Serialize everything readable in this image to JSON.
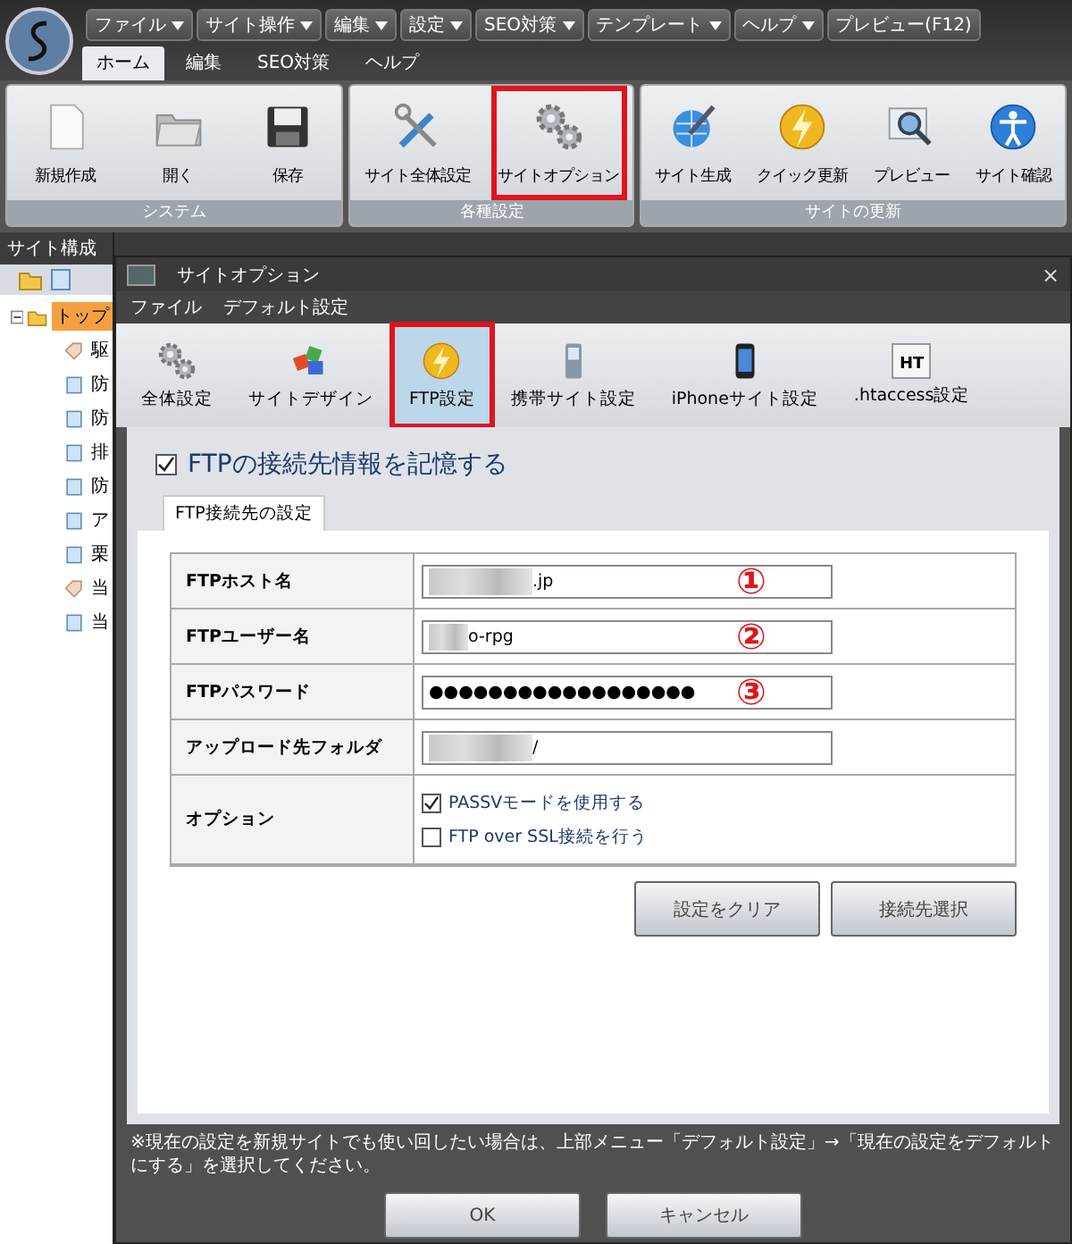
{
  "app": {
    "menu": [
      {
        "label": "ファイル",
        "kind": "dropdown"
      },
      {
        "label": "サイト操作",
        "kind": "dropdown"
      },
      {
        "label": "編集",
        "kind": "dropdown"
      },
      {
        "label": "設定",
        "kind": "dropdown"
      },
      {
        "label": "SEO対策",
        "kind": "dropdown"
      },
      {
        "label": "テンプレート",
        "kind": "dropdown"
      },
      {
        "label": "ヘルプ",
        "kind": "dropdown"
      },
      {
        "label": "プレビュー(F12)",
        "kind": "plain"
      }
    ],
    "ribbon_tabs": [
      {
        "label": "ホーム",
        "selected": true
      },
      {
        "label": "編集",
        "selected": false
      },
      {
        "label": "SEO対策",
        "selected": false
      },
      {
        "label": "ヘルプ",
        "selected": false
      }
    ],
    "ribbon_groups": [
      {
        "title": "システム",
        "items": [
          {
            "label": "新規作成",
            "kind": "new",
            "highlighted": false
          },
          {
            "label": "開く",
            "kind": "open",
            "highlighted": false
          },
          {
            "label": "保存",
            "kind": "save",
            "highlighted": false
          }
        ]
      },
      {
        "title": "各種設定",
        "items": [
          {
            "label": "サイト全体設定",
            "kind": "tools",
            "highlighted": false
          },
          {
            "label": "サイトオプション",
            "kind": "gears",
            "highlighted": true
          }
        ]
      },
      {
        "title": "サイトの更新",
        "items": [
          {
            "label": "サイト生成",
            "kind": "globe",
            "highlighted": false
          },
          {
            "label": "クイック更新",
            "kind": "bolt",
            "highlighted": false
          },
          {
            "label": "プレビュー",
            "kind": "preview",
            "highlighted": false
          },
          {
            "label": "サイト確認",
            "kind": "person",
            "highlighted": false
          }
        ]
      }
    ]
  },
  "sidebar": {
    "title": "サイト構成",
    "tree": [
      {
        "label": "トップ",
        "kind": "folder",
        "selected": true,
        "expanded": true,
        "children": [
          {
            "label": "駆",
            "kind": "tag"
          },
          {
            "label": "防",
            "kind": "page"
          },
          {
            "label": "防",
            "kind": "page"
          },
          {
            "label": "排",
            "kind": "page"
          },
          {
            "label": "防",
            "kind": "page"
          },
          {
            "label": "ア",
            "kind": "page"
          },
          {
            "label": "栗",
            "kind": "page"
          },
          {
            "label": "当",
            "kind": "tag"
          },
          {
            "label": "当",
            "kind": "page"
          }
        ]
      }
    ]
  },
  "dialog": {
    "title": "サイトオプション",
    "close": "×",
    "menu": [
      "ファイル",
      "デフォルト設定"
    ],
    "tabs": [
      {
        "label": "全体設定",
        "kind": "gears",
        "selected": false,
        "highlighted": false
      },
      {
        "label": "サイトデザイン",
        "kind": "blocks",
        "selected": false,
        "highlighted": false
      },
      {
        "label": "FTP設定",
        "kind": "bolt",
        "selected": true,
        "highlighted": true
      },
      {
        "label": "携帯サイト設定",
        "kind": "phone",
        "selected": false,
        "highlighted": false
      },
      {
        "label": "iPhoneサイト設定",
        "kind": "iphone",
        "selected": false,
        "highlighted": false
      },
      {
        "label": ".htaccess設定",
        "kind": "htaccess",
        "badge": "HT",
        "selected": false,
        "highlighted": false
      }
    ],
    "remember": {
      "label": "FTPの接続先情報を記憶する",
      "checked": true
    },
    "section_tab": "FTP接続先の設定",
    "fields": [
      {
        "kind": "text",
        "label": "FTPホスト名",
        "value": ".jp",
        "redacted": true,
        "marker": "①"
      },
      {
        "kind": "text",
        "label": "FTPユーザー名",
        "value": "o-rpg",
        "redacted": true,
        "marker": "②"
      },
      {
        "kind": "text",
        "label": "FTPパスワード",
        "value": "●●●●●●●●●●●●●●●●●●",
        "redacted": false,
        "marker": "③"
      },
      {
        "kind": "text",
        "label": "アップロード先フォルダ",
        "value": "/",
        "redacted": true
      },
      {
        "kind": "options",
        "label": "オプション",
        "options": [
          {
            "label": "PASSVモードを使用する",
            "checked": true
          },
          {
            "label": "FTP over SSL接続を行う",
            "checked": false
          }
        ]
      }
    ],
    "buttons": [
      "設定をクリア",
      "接続先選択"
    ],
    "note": "※現在の設定を新規サイトでも使い回したい場合は、上部メニュー「デフォルト設定」→「現在の設定をデフォルトにする」を選択してください。",
    "footer_buttons": [
      "OK",
      "キャンセル"
    ]
  }
}
